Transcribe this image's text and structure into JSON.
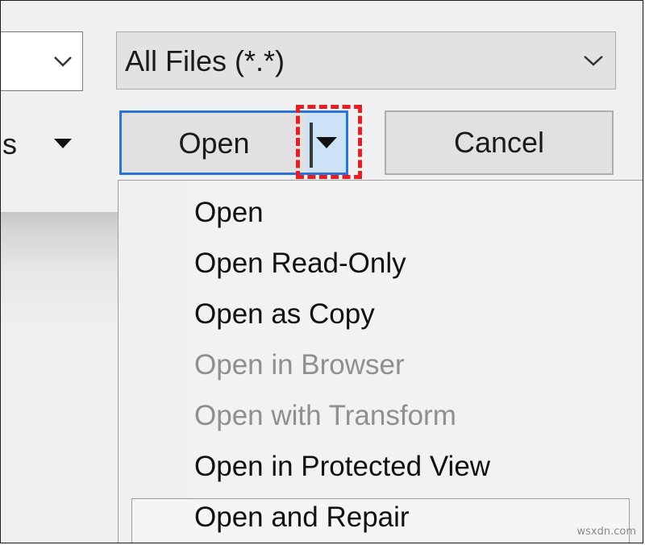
{
  "file_dialog": {
    "left_combo_value": "",
    "file_type_filter": "All Files (*.*)",
    "tools_label": "s",
    "open_button_label": "Open",
    "cancel_button_label": "Cancel"
  },
  "open_menu": {
    "items": [
      {
        "label": "Open",
        "enabled": true
      },
      {
        "label": "Open Read-Only",
        "enabled": true
      },
      {
        "label": "Open as Copy",
        "enabled": true
      },
      {
        "label": "Open in Browser",
        "enabled": false
      },
      {
        "label": "Open with Transform",
        "enabled": false
      },
      {
        "label": "Open in Protected View",
        "enabled": true
      },
      {
        "label": "Open and Repair",
        "enabled": true
      }
    ]
  },
  "annotation": {
    "highlight_color": "#e31e24"
  },
  "watermark": "wsxdn.com",
  "colors": {
    "focus_blue": "#2a74d6",
    "split_arrow_bg": "#cce3f7",
    "disabled_text": "#8f8f8f"
  }
}
